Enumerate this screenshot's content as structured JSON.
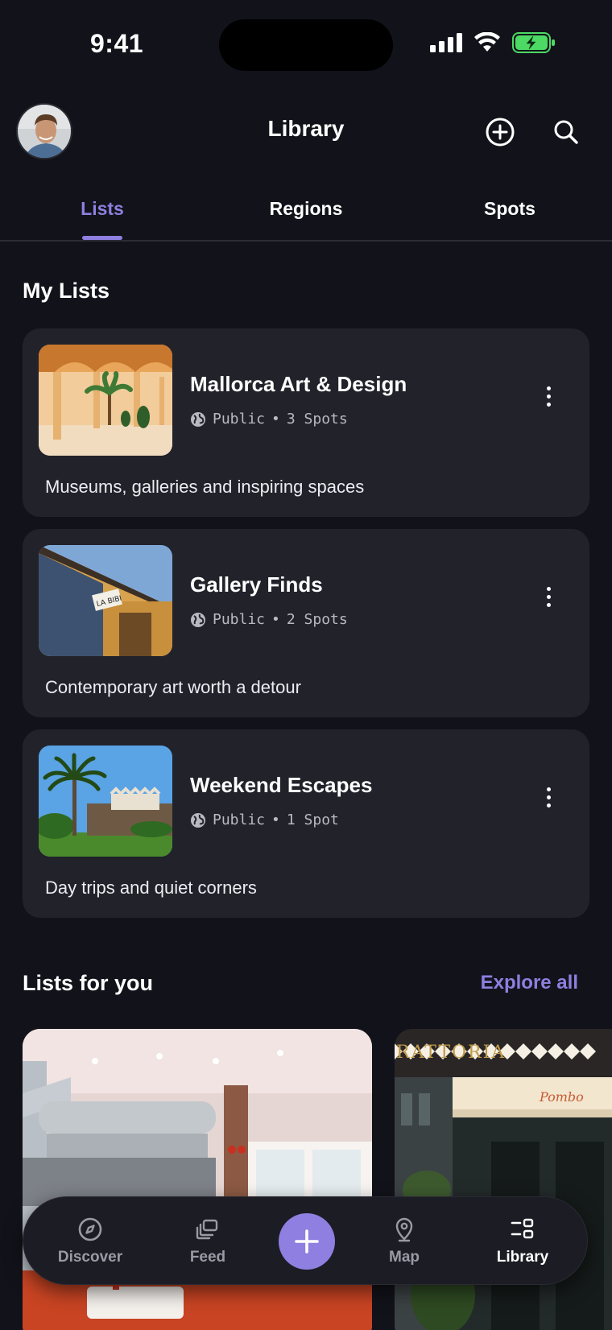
{
  "status_bar": {
    "time": "9:41"
  },
  "header": {
    "title": "Library"
  },
  "tabs": [
    {
      "label": "Lists",
      "active": true
    },
    {
      "label": "Regions",
      "active": false
    },
    {
      "label": "Spots",
      "active": false
    }
  ],
  "my_lists": {
    "title": "My Lists",
    "items": [
      {
        "title": "Mallorca Art & Design",
        "visibility": "Public",
        "count": "3 Spots",
        "description": "Museums, galleries and inspiring spaces",
        "thumb": "courtyard-arcade"
      },
      {
        "title": "Gallery Finds",
        "visibility": "Public",
        "count": "2 Spots",
        "description": "Contemporary art worth a detour",
        "thumb": "gallery-facade"
      },
      {
        "title": "Weekend Escapes",
        "visibility": "Public",
        "count": "1 Spot",
        "description": "Day trips and quiet corners",
        "thumb": "palm-castle"
      }
    ]
  },
  "for_you": {
    "title": "Lists for you",
    "explore_label": "Explore all"
  },
  "bottom_nav": {
    "items": [
      {
        "label": "Discover",
        "icon": "compass-icon"
      },
      {
        "label": "Feed",
        "icon": "cards-icon"
      },
      {
        "label": "Map",
        "icon": "map-pin-icon"
      },
      {
        "label": "Library",
        "icon": "library-icon",
        "active": true
      }
    ]
  },
  "colors": {
    "accent": "#8e7fe0",
    "background": "#12121a",
    "card": "#22222b"
  }
}
